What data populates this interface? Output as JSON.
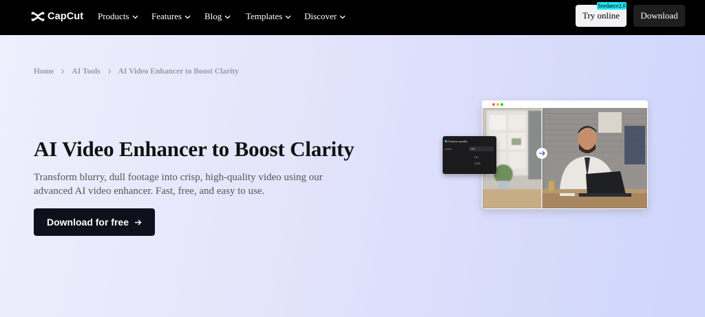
{
  "brand": {
    "name": "CapCut",
    "logo_icon": "capcut-logo-icon"
  },
  "nav": {
    "items": [
      {
        "label": "Products"
      },
      {
        "label": "Features"
      },
      {
        "label": "Blog"
      },
      {
        "label": "Templates"
      },
      {
        "label": "Discover"
      }
    ],
    "try_online": "Try online",
    "badge": "Seedance2.0",
    "download": "Download"
  },
  "breadcrumb": [
    "Home",
    "AI Tools",
    "AI Video Enhancer to Boost Clarity"
  ],
  "hero": {
    "title": "AI Video Enhancer to Boost Clarity",
    "subtitle": "Transform blurry, dull footage into crisp, high-quality video using our advanced AI video enhancer. Fast, free, and easy to use.",
    "cta": "Download for free"
  },
  "preview": {
    "panel_title": "Enhance quality",
    "panel_label": "Level",
    "selected": "HD",
    "options": [
      "HD",
      "UHD"
    ],
    "window_dots": [
      "#ff5f57",
      "#febc2e",
      "#28c840"
    ]
  },
  "colors": {
    "nav_bg": "#000000",
    "cta_bg": "#0e111c",
    "badge": "#1fe3f0"
  }
}
